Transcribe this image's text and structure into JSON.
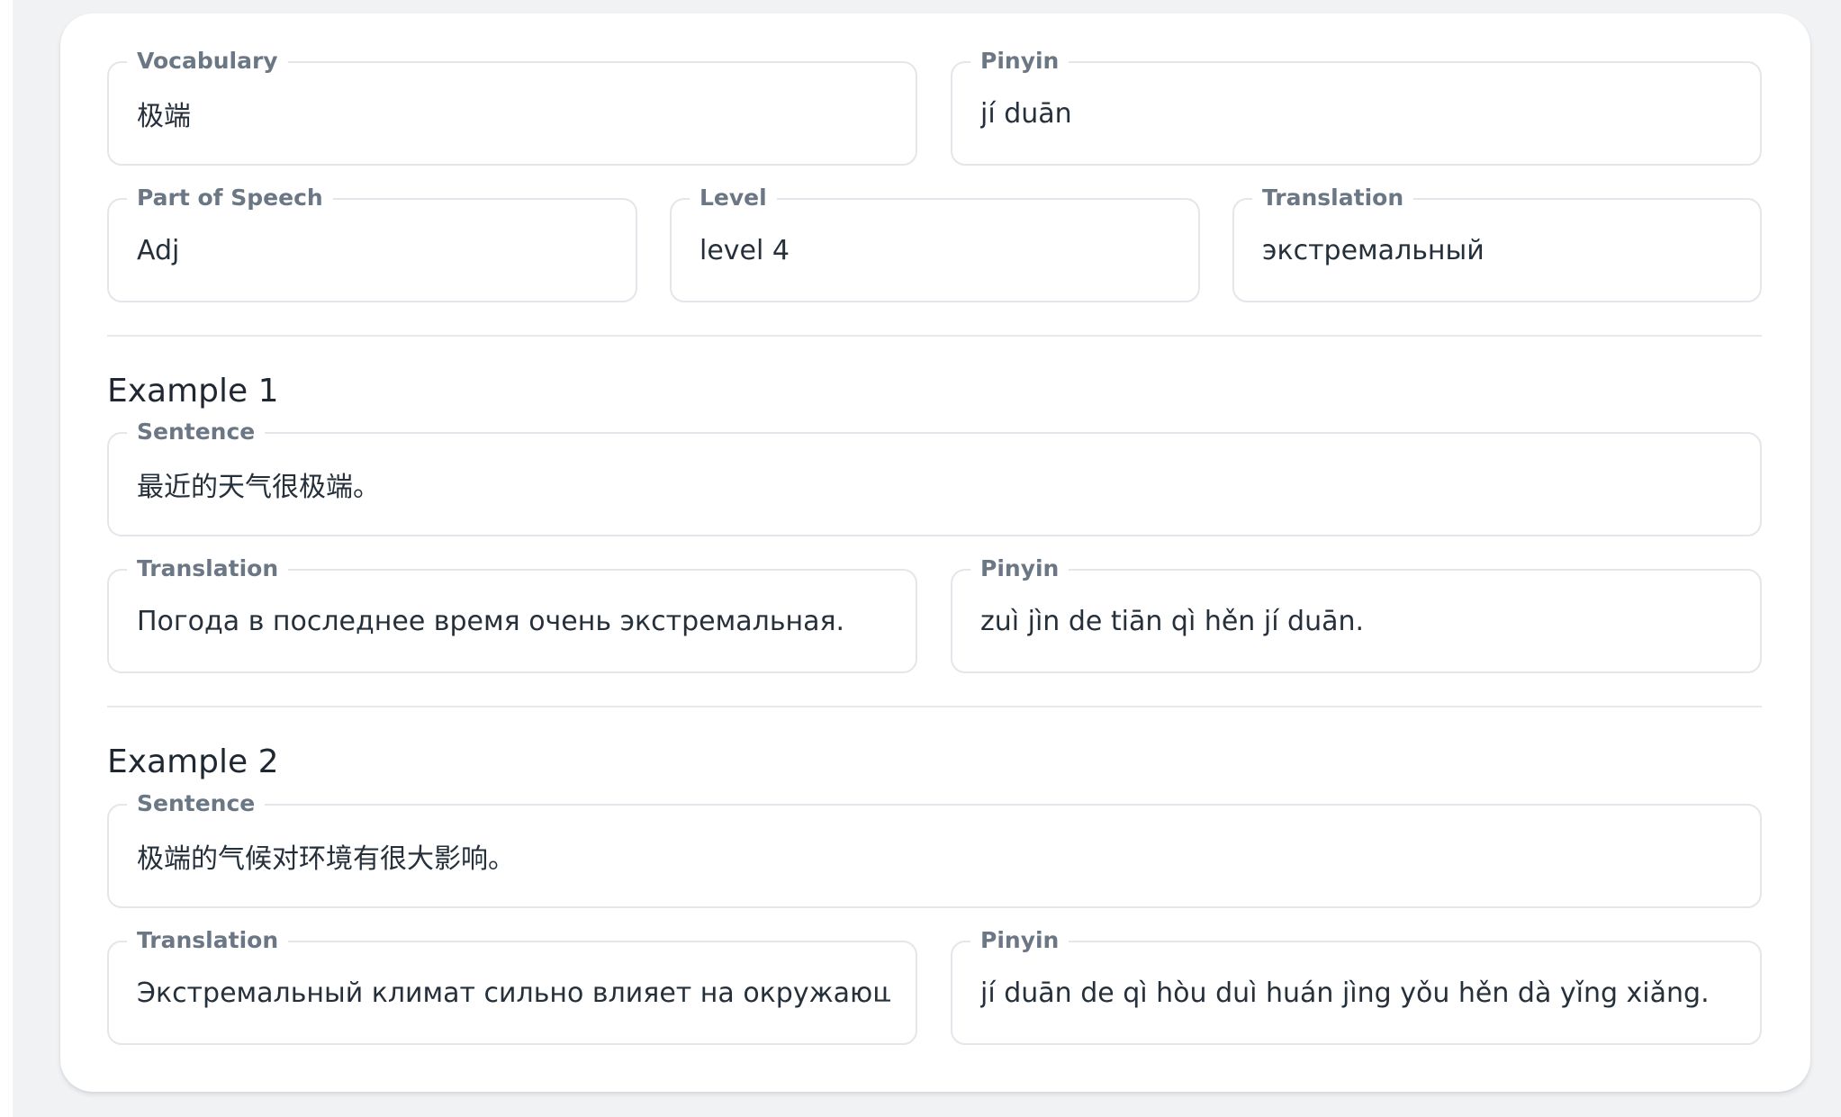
{
  "vocab": {
    "vocabulary": {
      "label": "Vocabulary",
      "value": "极端"
    },
    "pinyin": {
      "label": "Pinyin",
      "value": "jí duān"
    },
    "part_of_speech": {
      "label": "Part of Speech",
      "value": "Adj"
    },
    "level": {
      "label": "Level",
      "value": "level 4"
    },
    "translation": {
      "label": "Translation",
      "value": "экстремальный"
    }
  },
  "examples": [
    {
      "title": "Example 1",
      "sentence": {
        "label": "Sentence",
        "value": "最近的天气很极端。"
      },
      "translation": {
        "label": "Translation",
        "value": "Погода в последнее время очень экстремальная."
      },
      "pinyin": {
        "label": "Pinyin",
        "value": "zuì jìn de tiān qì hěn jí duān."
      }
    },
    {
      "title": "Example 2",
      "sentence": {
        "label": "Sentence",
        "value": "极端的气候对环境有很大影响。"
      },
      "translation": {
        "label": "Translation",
        "value": "Экстремальный климат сильно влияет на окружающую среду."
      },
      "pinyin": {
        "label": "Pinyin",
        "value": "jí duān de qì hòu duì huán jìng yǒu hěn dà yǐng xiǎng."
      }
    }
  ]
}
